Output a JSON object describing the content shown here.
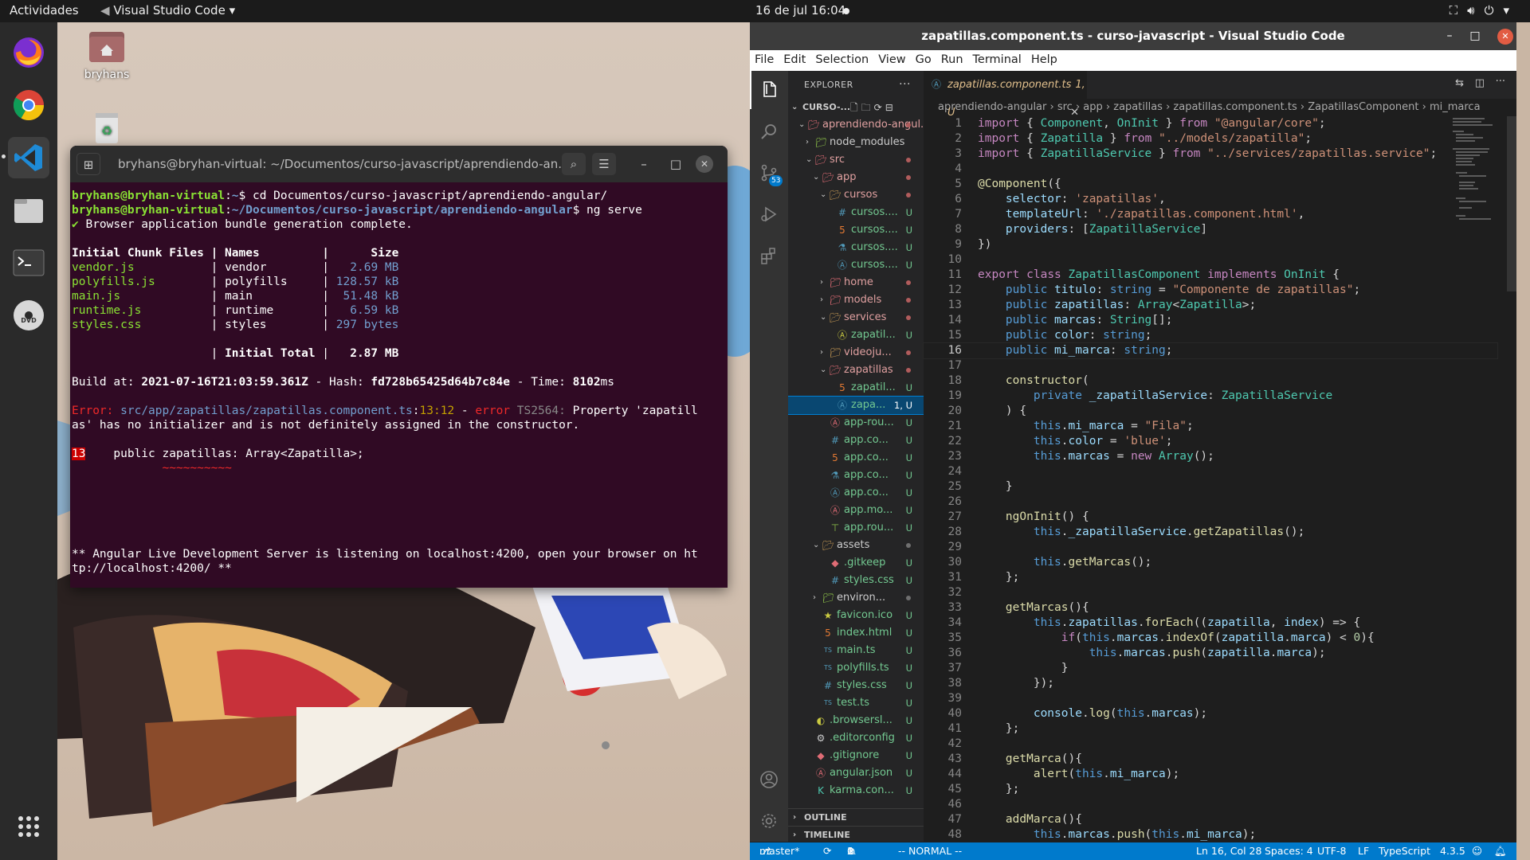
{
  "topbar": {
    "activities": "Actividades",
    "app_name": "Visual Studio Code",
    "clock": "16 de jul  16:04"
  },
  "desktop": {
    "home_label": "bryhans"
  },
  "terminal": {
    "title": "bryhans@bryhan-virtual: ~/Documentos/curso-javascript/aprendiendo-an...",
    "prompt1_user": "bryhans@bryhan-virtual",
    "prompt1_path": "~",
    "prompt1_cmd": "$ cd Documentos/curso-javascript/aprendiendo-angular/",
    "prompt2_user": "bryhans@bryhan-virtual",
    "prompt2_path": "~/Documentos/curso-javascript/aprendiendo-angular",
    "prompt2_cmd": "$ ng serve",
    "bundle_msg": "Browser application bundle generation complete.",
    "table_header": "Initial Chunk Files | Names         |      Size",
    "chunks": [
      {
        "file": "vendor.js",
        "name": "vendor",
        "size": "2.69 MB"
      },
      {
        "file": "polyfills.js",
        "name": "polyfills",
        "size": "128.57 kB"
      },
      {
        "file": "main.js",
        "name": "main",
        "size": "51.48 kB"
      },
      {
        "file": "runtime.js",
        "name": "runtime",
        "size": "6.59 kB"
      },
      {
        "file": "styles.css",
        "name": "styles",
        "size": "297 bytes"
      }
    ],
    "total_label": "Initial Total",
    "total_size": "2.87 MB",
    "build_at_label": "Build at:",
    "build_at": "2021-07-16T21:03:59.361Z",
    "hash_label": "Hash:",
    "hash": "fd728b65425d64b7c84e",
    "time_label": "Time:",
    "time": "8102",
    "time_unit": "ms",
    "error_label": "Error:",
    "error_file": "src/app/zapatillas/zapatillas.component.ts",
    "error_pos": "13:12",
    "error_kw": "error",
    "error_code": "TS2564:",
    "error_msg1": "Property 'zapatill",
    "error_msg2": "as' has no initializer and is not definitely assigned in the constructor.",
    "error_line_no": "13",
    "error_line": "    public zapatillas: Array<Zapatilla>;",
    "error_underline": "           ~~~~~~~~~~",
    "server_msg1": "** Angular Live Development Server is listening on localhost:4200, open your browser on ht",
    "server_msg2": "tp://localhost:4200/ **"
  },
  "vscode": {
    "window_title": "zapatillas.component.ts - curso-javascript - Visual Studio Code",
    "menu": [
      "File",
      "Edit",
      "Selection",
      "View",
      "Go",
      "Run",
      "Terminal",
      "Help"
    ],
    "explorer_title": "EXPLORER",
    "source_control_badge": "53",
    "workspace": "CURSO-...",
    "tree": [
      {
        "name": "aprendiendo-angul...",
        "depth": 1,
        "kind": "folder-open",
        "status": "dot",
        "color": "#e06c75"
      },
      {
        "name": "node_modules",
        "depth": 2,
        "kind": "folder",
        "status": "",
        "color": "#8dc149"
      },
      {
        "name": "src",
        "depth": 2,
        "kind": "folder-open",
        "status": "dot",
        "color": "#e06c75"
      },
      {
        "name": "app",
        "depth": 3,
        "kind": "folder-open",
        "status": "dot",
        "color": "#e06c75"
      },
      {
        "name": "cursos",
        "depth": 4,
        "kind": "folder-open",
        "status": "dot",
        "color": "#c09553"
      },
      {
        "name": "cursos....",
        "depth": 5,
        "kind": "css",
        "status": "U",
        "color": "#519aba"
      },
      {
        "name": "cursos....",
        "depth": 5,
        "kind": "html",
        "status": "U",
        "color": "#e37933"
      },
      {
        "name": "cursos....",
        "depth": 5,
        "kind": "spec",
        "status": "U",
        "color": "#519aba"
      },
      {
        "name": "cursos....",
        "depth": 5,
        "kind": "angular",
        "status": "U",
        "color": "#519aba"
      },
      {
        "name": "home",
        "depth": 4,
        "kind": "folder",
        "status": "dot",
        "color": "#e06c75"
      },
      {
        "name": "models",
        "depth": 4,
        "kind": "folder",
        "status": "dot",
        "color": "#e06c75"
      },
      {
        "name": "services",
        "depth": 4,
        "kind": "folder-open",
        "status": "dot",
        "color": "#c09553"
      },
      {
        "name": "zapatil...",
        "depth": 5,
        "kind": "angular",
        "status": "U",
        "color": "#cbcb41"
      },
      {
        "name": "videoju...",
        "depth": 4,
        "kind": "folder",
        "status": "dot",
        "color": "#c09553"
      },
      {
        "name": "zapatillas",
        "depth": 4,
        "kind": "folder-open",
        "status": "dot",
        "color": "#e06c75"
      },
      {
        "name": "zapatil...",
        "depth": 5,
        "kind": "html",
        "status": "U",
        "color": "#e37933"
      },
      {
        "name": "zapa...",
        "depth": 5,
        "kind": "angular",
        "status": "1, U",
        "color": "#519aba",
        "selected": true
      },
      {
        "name": "app-rou...",
        "depth": 4,
        "kind": "angular",
        "status": "U",
        "color": "#e06c75"
      },
      {
        "name": "app.co...",
        "depth": 4,
        "kind": "css",
        "status": "U",
        "color": "#519aba"
      },
      {
        "name": "app.co...",
        "depth": 4,
        "kind": "html",
        "status": "U",
        "color": "#e37933"
      },
      {
        "name": "app.co...",
        "depth": 4,
        "kind": "spec",
        "status": "U",
        "color": "#519aba"
      },
      {
        "name": "app.co...",
        "depth": 4,
        "kind": "angular",
        "status": "U",
        "color": "#519aba"
      },
      {
        "name": "app.mo...",
        "depth": 4,
        "kind": "angular",
        "status": "U",
        "color": "#e06c75"
      },
      {
        "name": "app.rou...",
        "depth": 4,
        "kind": "routing",
        "status": "U",
        "color": "#8dc149"
      },
      {
        "name": "assets",
        "depth": 3,
        "kind": "folder-open",
        "status": "dotg",
        "color": "#c09553"
      },
      {
        "name": ".gitkeep",
        "depth": 4,
        "kind": "git",
        "status": "U",
        "color": "#e06c75"
      },
      {
        "name": "styles.css",
        "depth": 4,
        "kind": "css",
        "status": "U",
        "color": "#519aba"
      },
      {
        "name": "environ...",
        "depth": 3,
        "kind": "folder",
        "status": "dotg",
        "color": "#8dc149"
      },
      {
        "name": "favicon.ico",
        "depth": 3,
        "kind": "star",
        "status": "U",
        "color": "#cbcb41"
      },
      {
        "name": "index.html",
        "depth": 3,
        "kind": "html",
        "status": "U",
        "color": "#e37933"
      },
      {
        "name": "main.ts",
        "depth": 3,
        "kind": "ts",
        "status": "U",
        "color": "#519aba"
      },
      {
        "name": "polyfills.ts",
        "depth": 3,
        "kind": "ts",
        "status": "U",
        "color": "#519aba"
      },
      {
        "name": "styles.css",
        "depth": 3,
        "kind": "css",
        "status": "U",
        "color": "#519aba"
      },
      {
        "name": "test.ts",
        "depth": 3,
        "kind": "ts",
        "status": "U",
        "color": "#519aba"
      },
      {
        "name": ".browsersl...",
        "depth": 2,
        "kind": "browserslist",
        "status": "U",
        "color": "#cbcb41"
      },
      {
        "name": ".editorconfig",
        "depth": 2,
        "kind": "gear",
        "status": "U",
        "color": "#cccccc"
      },
      {
        "name": ".gitignore",
        "depth": 2,
        "kind": "git",
        "status": "U",
        "color": "#e06c75"
      },
      {
        "name": "angular.json",
        "depth": 2,
        "kind": "angular",
        "status": "U",
        "color": "#e06c75"
      },
      {
        "name": "karma.con...",
        "depth": 2,
        "kind": "karma",
        "status": "U",
        "color": "#4ec9b0"
      }
    ],
    "outline_label": "OUTLINE",
    "timeline_label": "TIMELINE",
    "tab_label": "zapatillas.component.ts",
    "tab_status": "1, U",
    "breadcrumb": [
      "aprendiendo-angular",
      "src",
      "app",
      "zapatillas",
      "zapatillas.component.ts",
      "ZapatillasComponent",
      "mi_marca"
    ],
    "current_line": 16,
    "code_lines": [
      "import { Component, OnInit } from \"@angular/core\";",
      "import { Zapatilla } from \"../models/zapatilla\";",
      "import { ZapatillaService } from \"../services/zapatillas.service\";",
      "",
      "@Component({",
      "    selector: 'zapatillas',",
      "    templateUrl: './zapatillas.component.html',",
      "    providers: [ZapatillaService]",
      "})",
      "",
      "export class ZapatillasComponent implements OnInit {",
      "    public titulo: string = \"Componente de zapatillas\";",
      "    public zapatillas: Array<Zapatilla>;",
      "    public marcas: String[];",
      "    public color: string;",
      "    public mi_marca: string;",
      "",
      "    constructor(",
      "        private _zapatillaService: ZapatillaService",
      "    ) {",
      "        this.mi_marca = \"Fila\";",
      "        this.color = 'blue';",
      "        this.marcas = new Array();",
      "",
      "    }",
      "",
      "    ngOnInit() {",
      "        this._zapatillaService.getZapatillas();",
      "",
      "        this.getMarcas();",
      "    };",
      "",
      "    getMarcas(){",
      "        this.zapatillas.forEach((zapatilla, index) => {",
      "            if(this.marcas.indexOf(zapatilla.marca) < 0){",
      "                this.marcas.push(zapatilla.marca);",
      "            }",
      "        });",
      "",
      "        console.log(this.marcas);",
      "    };",
      "",
      "    getMarca(){",
      "        alert(this.mi_marca);",
      "    };",
      "",
      "    addMarca(){",
      "        this.marcas.push(this.mi_marca);"
    ],
    "status": {
      "branch": "master*",
      "errors": "1",
      "warnings": "0",
      "mode": "-- NORMAL --",
      "position": "Ln 16, Col 28",
      "spaces": "Spaces: 4",
      "encoding": "UTF-8",
      "eol": "LF",
      "language": "TypeScript",
      "version": "4.3.5"
    }
  }
}
